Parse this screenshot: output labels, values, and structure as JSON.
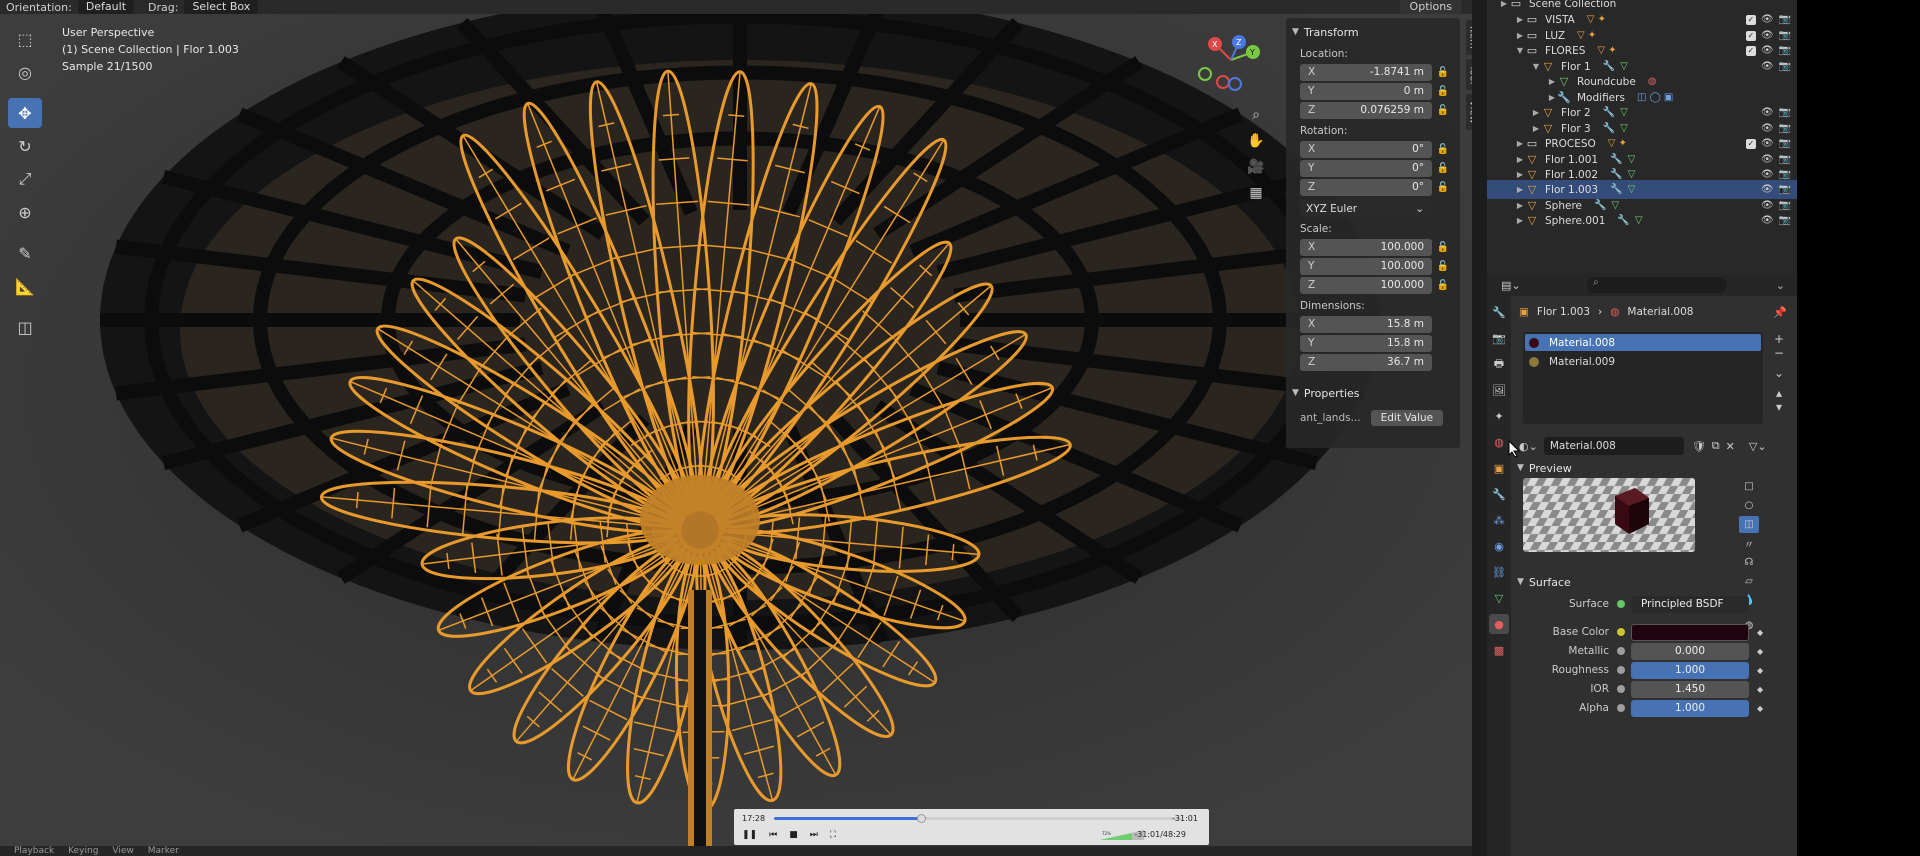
{
  "viewport_header": {
    "orientation_label": "Orientation:",
    "orientation_value": "Default",
    "drag_label": "Drag:",
    "drag_value": "Select Box",
    "options_label": "Options"
  },
  "viewport_info": {
    "perspective": "User Perspective",
    "collection": "(1) Scene Collection | Flor 1.003",
    "sample": "Sample 21/1500"
  },
  "n_panel": {
    "transform_title": "Transform",
    "location_label": "Location:",
    "location": [
      {
        "axis": "X",
        "value": "-1.8741 m"
      },
      {
        "axis": "Y",
        "value": "0 m"
      },
      {
        "axis": "Z",
        "value": "0.076259 m"
      }
    ],
    "rotation_label": "Rotation:",
    "rotation": [
      {
        "axis": "X",
        "value": "0°"
      },
      {
        "axis": "Y",
        "value": "0°"
      },
      {
        "axis": "Z",
        "value": "0°"
      }
    ],
    "rotation_mode": "XYZ Euler",
    "scale_label": "Scale:",
    "scale": [
      {
        "axis": "X",
        "value": "100.000"
      },
      {
        "axis": "Y",
        "value": "100.000"
      },
      {
        "axis": "Z",
        "value": "100.000"
      }
    ],
    "dimensions_label": "Dimensions:",
    "dimensions": [
      {
        "axis": "X",
        "value": "15.8 m"
      },
      {
        "axis": "Y",
        "value": "15.8 m"
      },
      {
        "axis": "Z",
        "value": "36.7 m"
      }
    ],
    "properties_title": "Properties",
    "prop_key": "ant_lands...",
    "prop_button": "Edit Value"
  },
  "side_tabs": [
    "Item",
    "Tool",
    "View"
  ],
  "timeline": {
    "current": "17:28",
    "remaining": "-31:01",
    "total": "-31:01/48:29",
    "progress": 0.36,
    "volume_label": "72%"
  },
  "bottom_bar": [
    "Playback",
    "Keying",
    "View",
    "Marker"
  ],
  "outliner": {
    "rows": [
      {
        "name": "Scene Collection",
        "indent": 0,
        "icon": "collection-icon"
      },
      {
        "name": "VISTA",
        "indent": 1,
        "icon": "collection-icon"
      },
      {
        "name": "LUZ",
        "indent": 1,
        "icon": "collection-icon"
      },
      {
        "name": "FLORES",
        "indent": 1,
        "icon": "collection-icon"
      },
      {
        "name": "Flor 1",
        "indent": 2,
        "icon": "object-icon"
      },
      {
        "name": "Roundcube",
        "indent": 3,
        "icon": "mesh-icon"
      },
      {
        "name": "Modifiers",
        "indent": 3,
        "icon": "modifier-icon"
      },
      {
        "name": "Flor 2",
        "indent": 2,
        "icon": "object-icon"
      },
      {
        "name": "Flor 3",
        "indent": 2,
        "icon": "object-icon"
      },
      {
        "name": "PROCESO",
        "indent": 1,
        "icon": "collection-icon"
      },
      {
        "name": "Flor 1.001",
        "indent": 1,
        "icon": "object-icon"
      },
      {
        "name": "Flor 1.002",
        "indent": 1,
        "icon": "object-icon"
      },
      {
        "name": "Flor 1.003",
        "indent": 1,
        "icon": "object-icon",
        "selected": true
      },
      {
        "name": "Sphere",
        "indent": 1,
        "icon": "object-icon"
      },
      {
        "name": "Sphere.001",
        "indent": 1,
        "icon": "object-icon"
      }
    ]
  },
  "properties": {
    "breadcrumb_object": "Flor 1.003",
    "breadcrumb_material": "Material.008",
    "slots": [
      "Material.008",
      "Material.009"
    ],
    "material_name": "Material.008",
    "preview_title": "Preview",
    "surface_title": "Surface",
    "surface": [
      {
        "label": "Surface",
        "value": "Principled BSDF"
      },
      {
        "label": "Base Color",
        "value": ""
      },
      {
        "label": "Metallic",
        "value": "0.000"
      },
      {
        "label": "Roughness",
        "value": "1.000"
      },
      {
        "label": "IOR",
        "value": "1.450"
      },
      {
        "label": "Alpha",
        "value": "1.000"
      }
    ]
  },
  "colors": {
    "accent": "#4772b3",
    "wireframe": "#e89a2c",
    "selected_row": "#334c79"
  }
}
